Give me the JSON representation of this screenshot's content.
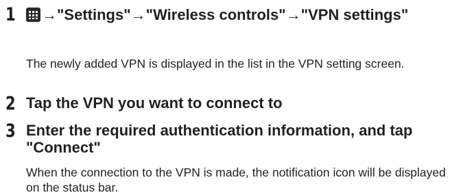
{
  "steps": [
    {
      "number": "1",
      "title_before_icon": "",
      "icon": "app-grid-icon",
      "title": "→\"Settings\"→\"Wireless controls\"→\"VPN settings\"",
      "description": "The newly added VPN is displayed in the list in the VPN setting screen."
    },
    {
      "number": "2",
      "title": "Tap the VPN you want to connect to"
    },
    {
      "number": "3",
      "title": "Enter the required authentication information, and tap \"Connect\"",
      "description": "When the connection to the VPN is made, the notification icon will be displayed on the status bar."
    }
  ]
}
